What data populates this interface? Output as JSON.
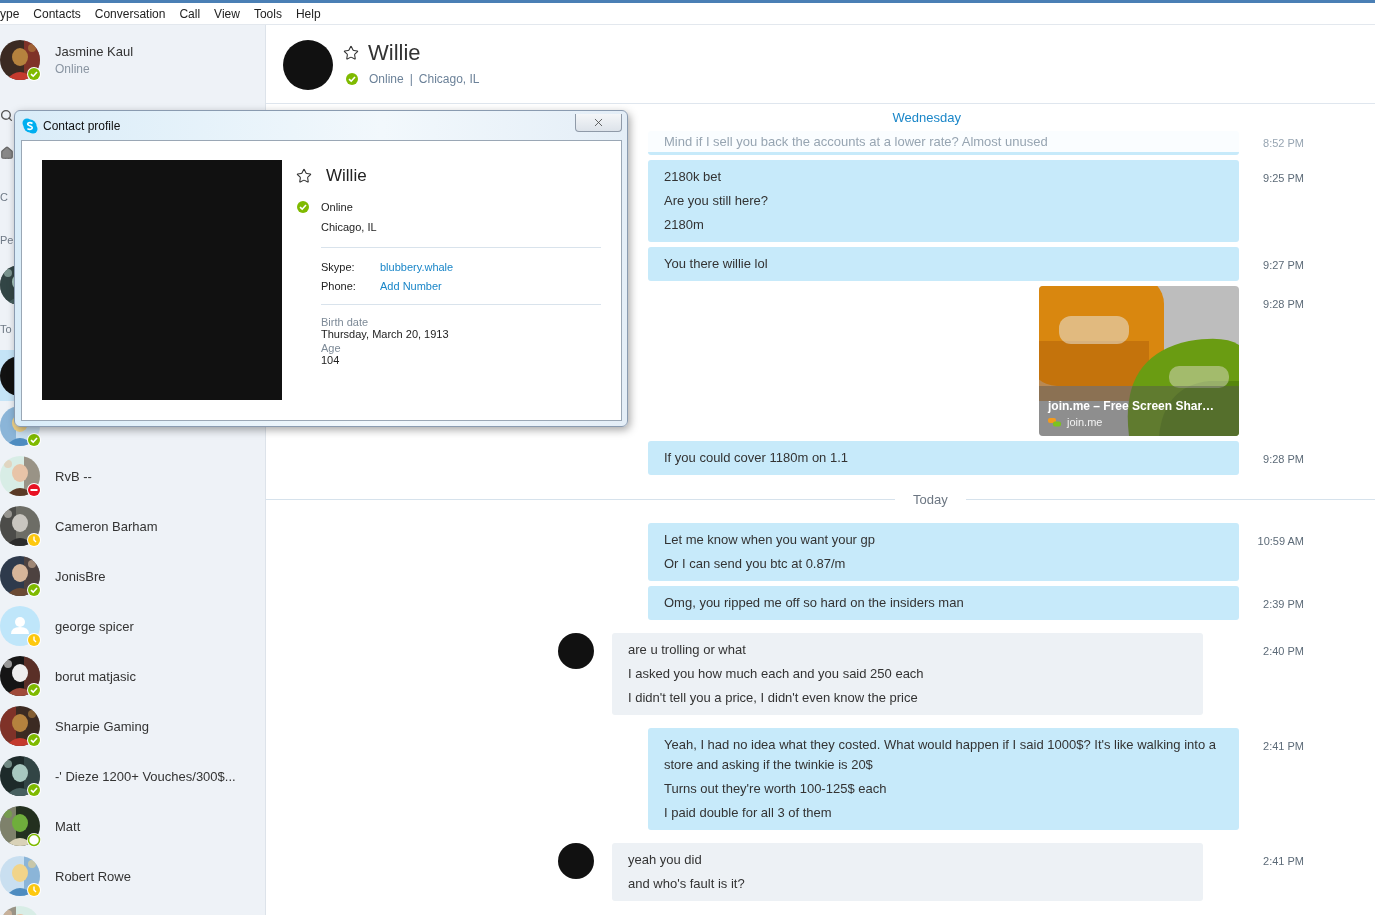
{
  "menu": [
    "ype",
    "Contacts",
    "Conversation",
    "Call",
    "View",
    "Tools",
    "Help"
  ],
  "me": {
    "name": "Jasmine Kaul",
    "status_text": "Online",
    "status": {
      "kind": "online"
    }
  },
  "sidebar_rows": [
    {
      "kind": "search"
    },
    {
      "kind": "home"
    },
    {
      "kind": "label",
      "text": "C"
    },
    {
      "kind": "label",
      "text": "Pe"
    },
    {
      "kind": "contact",
      "selected": false
    },
    {
      "kind": "label",
      "text": "To"
    },
    {
      "kind": "contact",
      "avatar": {
        "kind": "blank"
      },
      "selected": true
    },
    {
      "kind": "contact",
      "status": {
        "kind": "online"
      },
      "selected": false
    },
    {
      "kind": "contact",
      "name": "RvB --",
      "status": {
        "kind": "busy"
      },
      "selected": false
    },
    {
      "kind": "contact",
      "name": "Cameron Barham",
      "status": {
        "kind": "away"
      },
      "selected": false
    },
    {
      "kind": "contact",
      "name": "JonisBre",
      "status": {
        "kind": "online"
      },
      "selected": false
    },
    {
      "kind": "contact",
      "name": "george spicer",
      "avatar": {
        "kind": "default"
      },
      "status": {
        "kind": "away"
      },
      "selected": false
    },
    {
      "kind": "contact",
      "name": "borut matjasic",
      "status": {
        "kind": "online"
      },
      "selected": false
    },
    {
      "kind": "contact",
      "name": "Sharpie Gaming",
      "status": {
        "kind": "online"
      },
      "selected": false
    },
    {
      "kind": "contact",
      "name": "-' Dieze 1200+ Vouches/300$...",
      "status": {
        "kind": "online"
      },
      "selected": false
    },
    {
      "kind": "contact",
      "name": "Matt",
      "status": {
        "kind": "idle"
      },
      "selected": false
    },
    {
      "kind": "contact",
      "name": "Robert Rowe",
      "status": {
        "kind": "away"
      },
      "selected": false
    },
    {
      "kind": "contact",
      "selected": false
    }
  ],
  "chat_header": {
    "name": "Willie",
    "favorite": false,
    "status": {
      "kind": "online"
    },
    "status_text": "Online",
    "separator": "|",
    "location": "Chicago, IL"
  },
  "chat": {
    "items": [
      {
        "kind": "daylabel",
        "label": "Wednesday"
      },
      {
        "kind": "message",
        "incoming": false,
        "faded": true,
        "lines": [
          "Mind if I sell you back the accounts at a lower rate? Almost unused"
        ],
        "time": "8:52 PM"
      },
      {
        "kind": "message",
        "incoming": false,
        "faded": false,
        "lines": [
          "2180k bet",
          "Are you still here?",
          "2180m"
        ],
        "time": "9:25 PM"
      },
      {
        "kind": "message",
        "incoming": false,
        "faded": false,
        "lines": [
          "You there willie lol"
        ],
        "time": "9:27 PM"
      },
      {
        "kind": "link",
        "title": "join.me – Free Screen Shar…",
        "domain": "join.me",
        "time": "9:28 PM"
      },
      {
        "kind": "message",
        "incoming": false,
        "faded": false,
        "lines": [
          "If you could cover 1180m on 1.1"
        ],
        "time": "9:28 PM"
      },
      {
        "kind": "day",
        "label": "Today"
      },
      {
        "kind": "message",
        "incoming": false,
        "faded": false,
        "lines": [
          "Let me know when you want your gp",
          "Or I can send you btc at 0.87/m"
        ],
        "time": "10:59 AM"
      },
      {
        "kind": "message",
        "incoming": false,
        "faded": false,
        "lines": [
          "Omg, you ripped me off so hard on the insiders man"
        ],
        "time": "2:39 PM"
      },
      {
        "kind": "message",
        "incoming": true,
        "faded": false,
        "lines": [
          "are u trolling or what",
          "I asked you how much each and you said 250 each",
          "I didn't tell you a price, I didn't even know the price"
        ],
        "time": "2:40 PM"
      },
      {
        "kind": "message",
        "incoming": false,
        "faded": false,
        "lines": [
          "Yeah, I had no idea what they costed. What would happen if I said 1000$? It's like walking into a store and asking if the twinkie is 20$",
          "Turns out they're worth 100-125$ each",
          "I paid double for all 3 of them"
        ],
        "time": "2:41 PM"
      },
      {
        "kind": "message",
        "incoming": true,
        "faded": false,
        "lines": [
          "yeah you did",
          "and who's fault is it?"
        ],
        "time": "2:41 PM"
      }
    ]
  },
  "profile_dialog": {
    "title": "Contact profile",
    "name": "Willie",
    "favorite": false,
    "status": {
      "kind": "online"
    },
    "status_text": "Online",
    "location": "Chicago, IL",
    "fields": [
      {
        "label": "Skype:",
        "value": "blubbery.whale"
      },
      {
        "label": "Phone:",
        "value": "Add Number"
      }
    ],
    "details": [
      {
        "label": "Birth date",
        "value": "Thursday, March 20, 1913"
      },
      {
        "label": "Age",
        "value": "104"
      }
    ]
  }
}
